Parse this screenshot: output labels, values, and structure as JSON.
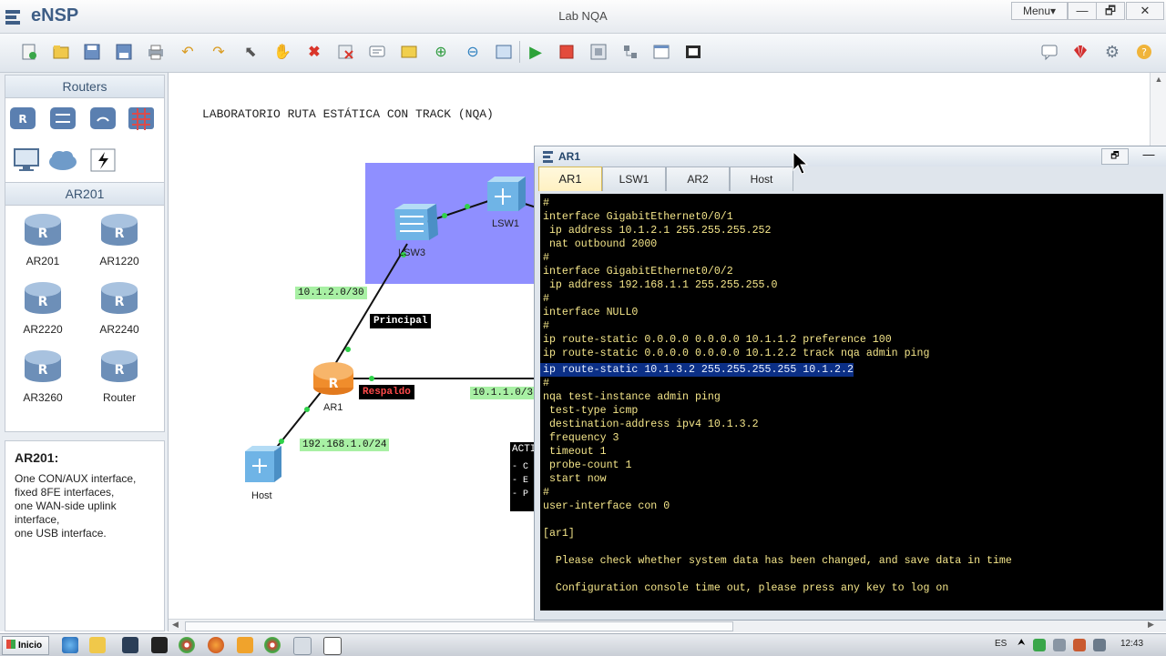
{
  "titlebar": {
    "app_name": "eNSP",
    "window_title": "Lab NQA",
    "menu_label": "Menu▾",
    "minimize": "—",
    "restore": "🗗",
    "close": "✕"
  },
  "toolbar": {
    "icons": [
      "new-topology",
      "open",
      "save",
      "save-as",
      "print",
      "undo",
      "redo",
      "select",
      "pan",
      "delete",
      "delete-links",
      "text",
      "palette",
      "zoom-in",
      "zoom-out",
      "fit",
      "start",
      "stop",
      "capture",
      "topology",
      "console-window",
      "screenshot"
    ],
    "right_icons": [
      "chat",
      "huawei-logo",
      "settings",
      "help"
    ]
  },
  "left_panel": {
    "routers_header": "Routers",
    "ar201_header": "AR201",
    "devices": [
      "AR201",
      "AR1220",
      "AR2220",
      "AR2240",
      "AR3260",
      "Router"
    ],
    "info_title": "AR201:",
    "info_text": "One CON/AUX interface,\nfixed 8FE interfaces,\none WAN-side uplink\ninterface,\none USB interface."
  },
  "canvas": {
    "lab_title": "LABORATORIO RUTA ESTÁTICA CON TRACK (NQA)",
    "nodes": {
      "lsw3": "LSW3",
      "lsw1": "LSW1",
      "ar1": "AR1",
      "host": "Host"
    },
    "labels": {
      "net_10_1_2": "10.1.2.0/30",
      "principal": "Principal",
      "respaldo": "Respaldo",
      "net_10_1_1": "10.1.1.0/3",
      "net_192": "192.168.1.0/24",
      "acti": "ACTI",
      "acti_lines": [
        "- C",
        "- E",
        "- P"
      ]
    }
  },
  "console": {
    "title": "AR1",
    "tabs": [
      "AR1",
      "LSW1",
      "AR2",
      "Host"
    ],
    "active_tab": "AR1",
    "lines": [
      "#",
      "interface GigabitEthernet0/0/1",
      " ip address 10.1.2.1 255.255.255.252",
      " nat outbound 2000",
      "#",
      "interface GigabitEthernet0/0/2",
      " ip address 192.168.1.1 255.255.255.0",
      "#",
      "interface NULL0",
      "#",
      "ip route-static 0.0.0.0 0.0.0.0 10.1.1.2 preference 100",
      "ip route-static 0.0.0.0 0.0.0.0 10.1.2.2 track nqa admin ping",
      "ip route-static 10.1.3.2 255.255.255.255 10.1.2.2",
      "#",
      "nqa test-instance admin ping",
      " test-type icmp",
      " destination-address ipv4 10.1.3.2",
      " frequency 3",
      " timeout 1",
      " probe-count 1",
      " start now",
      "#",
      "user-interface con 0",
      "",
      "[ar1]",
      "",
      "  Please check whether system data has been changed, and save data in time",
      "",
      "  Configuration console time out, please press any key to log on"
    ],
    "highlighted_line_index": 12
  },
  "taskbar": {
    "start_label": "Inicio",
    "lang": "ES",
    "clock": "12:43"
  },
  "colors": {
    "terminal_text": "#f5e68a",
    "terminal_bg": "#000000",
    "label_green": "#a8f0a4",
    "lab_area": "#8f8fff"
  }
}
